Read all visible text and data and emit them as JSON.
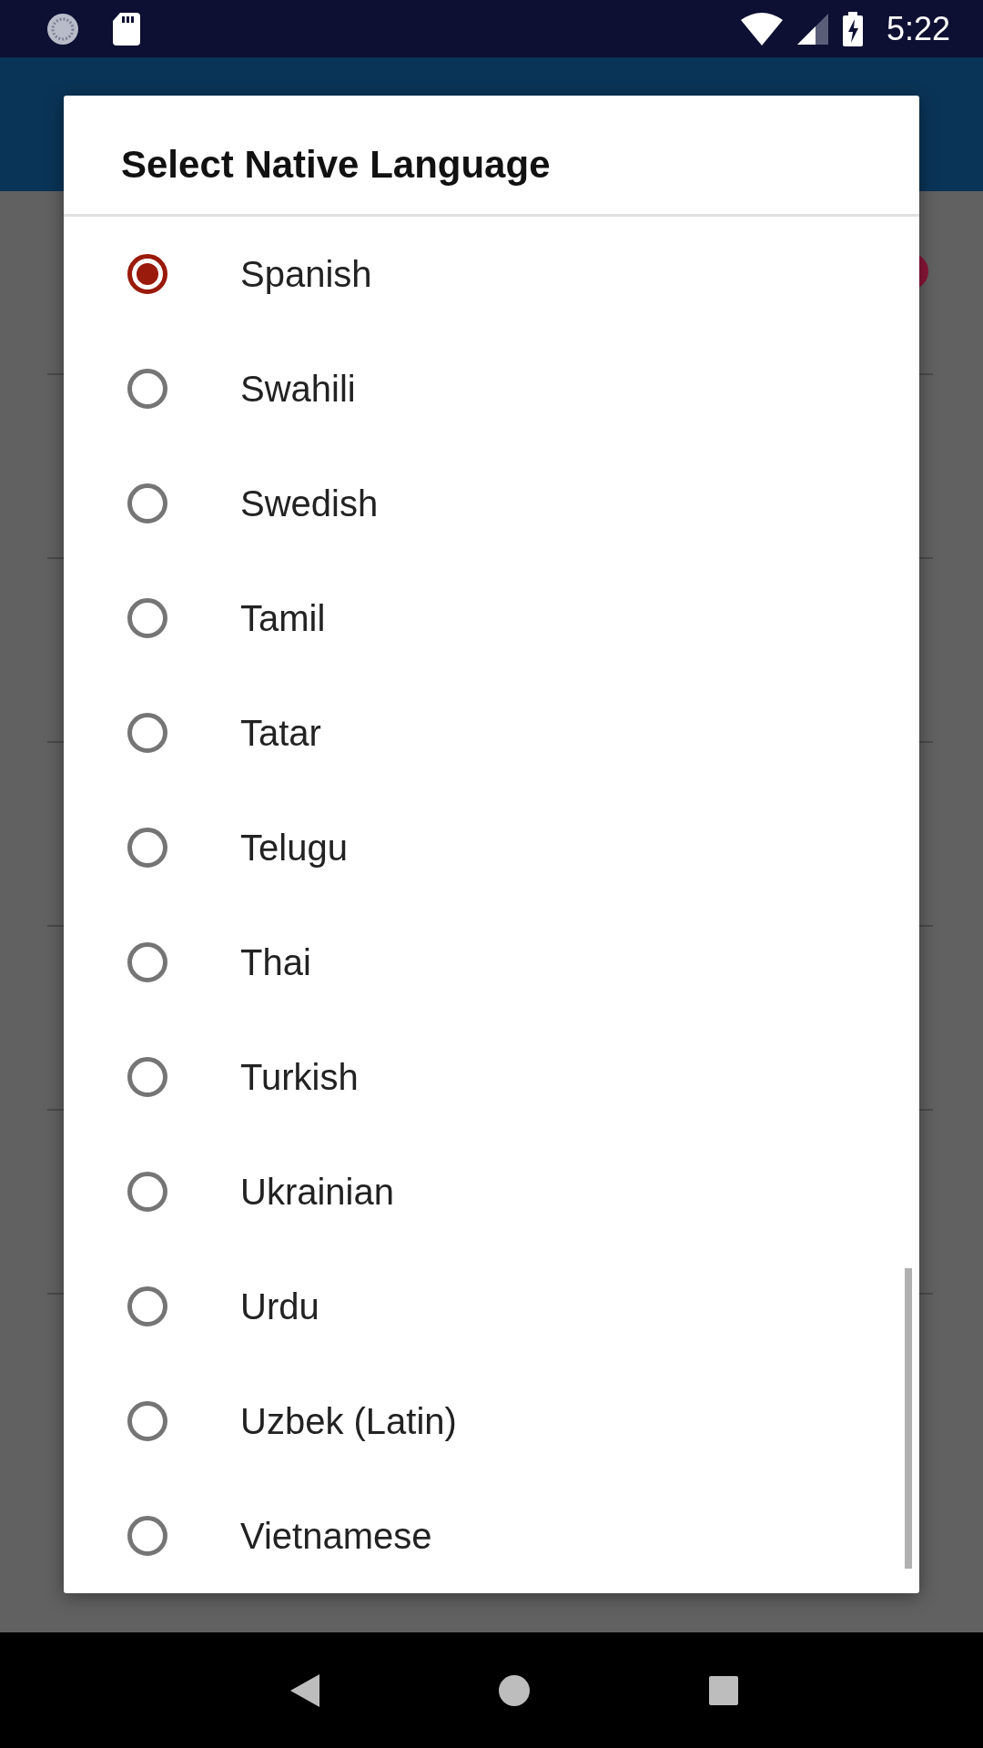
{
  "status_bar": {
    "time": "5:22"
  },
  "dialog": {
    "title": "Select Native Language",
    "options": [
      {
        "label": "Spanish",
        "selected": true
      },
      {
        "label": "Swahili",
        "selected": false
      },
      {
        "label": "Swedish",
        "selected": false
      },
      {
        "label": "Tamil",
        "selected": false
      },
      {
        "label": "Tatar",
        "selected": false
      },
      {
        "label": "Telugu",
        "selected": false
      },
      {
        "label": "Thai",
        "selected": false
      },
      {
        "label": "Turkish",
        "selected": false
      },
      {
        "label": "Ukrainian",
        "selected": false
      },
      {
        "label": "Urdu",
        "selected": false
      },
      {
        "label": "Uzbek (Latin)",
        "selected": false
      },
      {
        "label": "Vietnamese",
        "selected": false
      }
    ]
  }
}
